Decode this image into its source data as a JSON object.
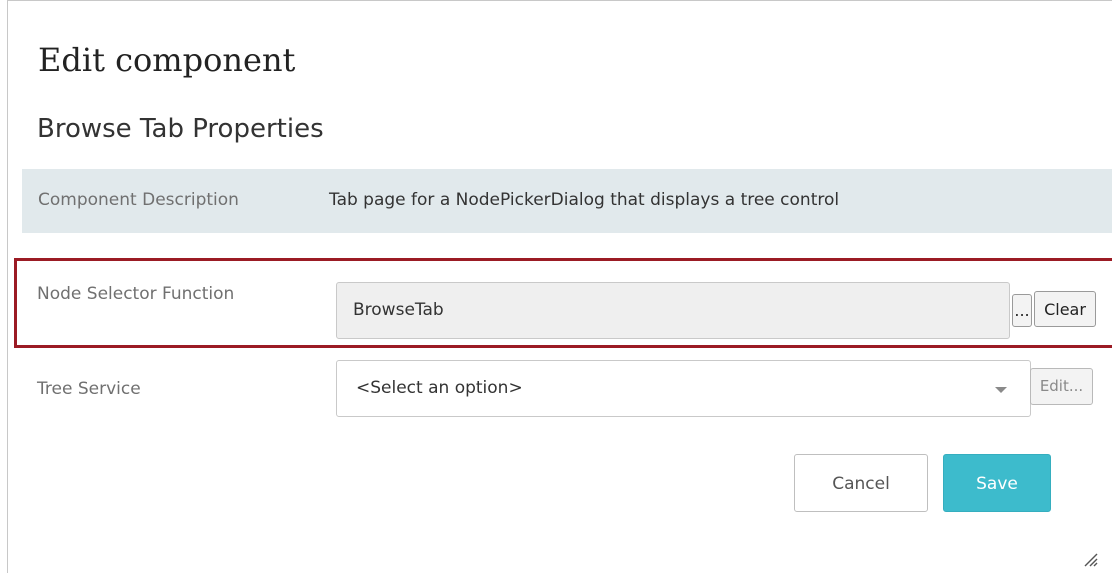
{
  "dialog": {
    "title": "Edit component",
    "section_title": "Browse Tab Properties"
  },
  "description": {
    "label": "Component Description",
    "value": "Tab page for a NodePickerDialog that displays a tree control"
  },
  "node_selector": {
    "label": "Node Selector Function",
    "value": "BrowseTab",
    "browse_label": "...",
    "clear_label": "Clear"
  },
  "tree_service": {
    "label": "Tree Service",
    "selected": "<Select an option>",
    "edit_label": "Edit..."
  },
  "actions": {
    "cancel_label": "Cancel",
    "save_label": "Save"
  },
  "colors": {
    "accent": "#3dbbcc",
    "highlight_border": "#9b1b24",
    "description_bg": "#e1e9ec"
  },
  "icons": {
    "dropdown": "chevron-down-icon",
    "resize": "resize-grip-icon"
  }
}
